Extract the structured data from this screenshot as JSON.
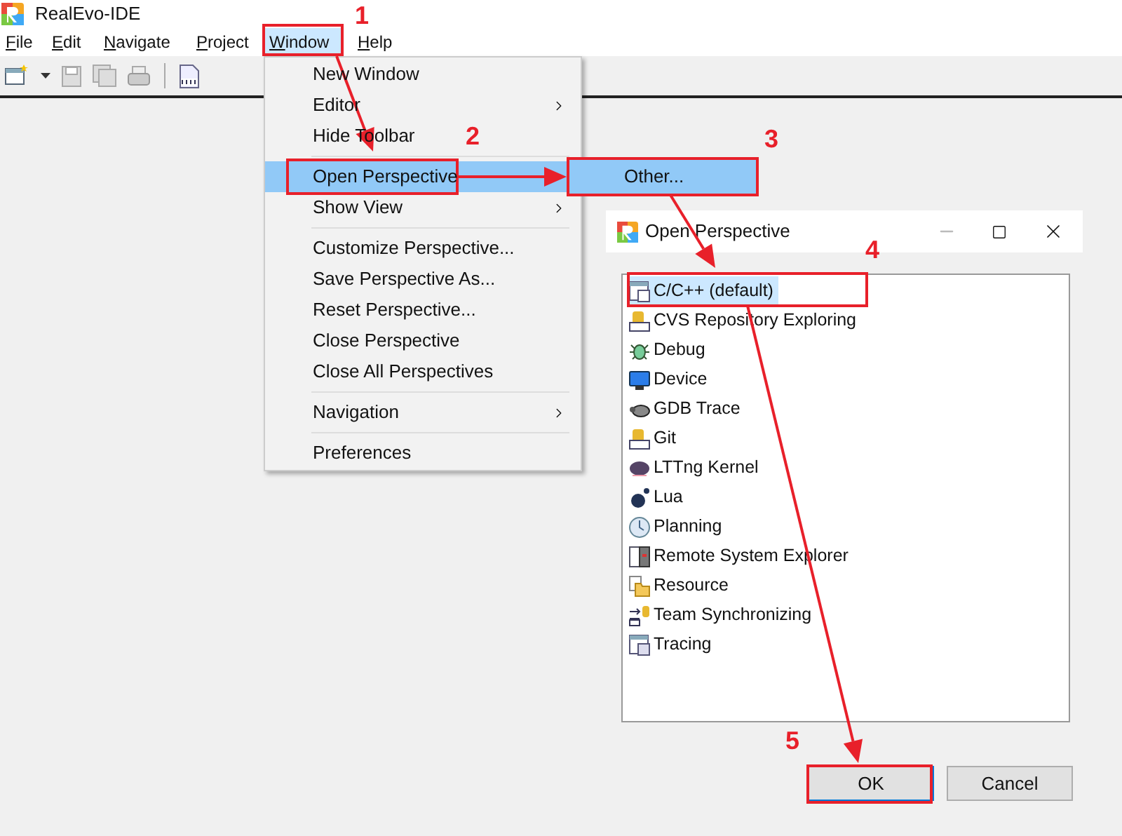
{
  "window": {
    "title": "RealEvo-IDE"
  },
  "menu_bar": [
    {
      "label": "File",
      "selected": false
    },
    {
      "label": "Edit",
      "selected": false
    },
    {
      "label": "Navigate",
      "selected": false
    },
    {
      "label": "Project",
      "selected": false
    },
    {
      "label": "Window",
      "selected": true
    },
    {
      "label": "Help",
      "selected": false
    }
  ],
  "window_menu": [
    {
      "kind": "item",
      "label": "New Window",
      "selected": false
    },
    {
      "kind": "submenu",
      "label": "Editor",
      "selected": false
    },
    {
      "kind": "item",
      "label": "Hide Toolbar",
      "selected": false
    },
    {
      "kind": "separator"
    },
    {
      "kind": "item",
      "label": "Open Perspective",
      "selected": true
    },
    {
      "kind": "submenu",
      "label": "Show View",
      "selected": false
    },
    {
      "kind": "separator"
    },
    {
      "kind": "item",
      "label": "Customize Perspective...",
      "selected": false
    },
    {
      "kind": "item",
      "label": "Save Perspective As...",
      "selected": false
    },
    {
      "kind": "item",
      "label": "Reset Perspective...",
      "selected": false
    },
    {
      "kind": "item",
      "label": "Close Perspective",
      "selected": false
    },
    {
      "kind": "item",
      "label": "Close All Perspectives",
      "selected": false
    },
    {
      "kind": "separator"
    },
    {
      "kind": "submenu",
      "label": "Navigation",
      "selected": false
    },
    {
      "kind": "separator"
    },
    {
      "kind": "item",
      "label": "Preferences",
      "selected": false
    }
  ],
  "perspective_submenu": [
    {
      "label": "Other...",
      "selected": true
    }
  ],
  "dialog": {
    "title": "Open Perspective",
    "perspectives": [
      {
        "label": "C/C++ (default)",
        "selected": true
      },
      {
        "label": "CVS Repository Exploring",
        "selected": false
      },
      {
        "label": "Debug",
        "selected": false
      },
      {
        "label": "Device",
        "selected": false
      },
      {
        "label": "GDB Trace",
        "selected": false
      },
      {
        "label": "Git",
        "selected": false
      },
      {
        "label": "LTTng Kernel",
        "selected": false
      },
      {
        "label": "Lua",
        "selected": false
      },
      {
        "label": "Planning",
        "selected": false
      },
      {
        "label": "Remote System Explorer",
        "selected": false
      },
      {
        "label": "Resource",
        "selected": false
      },
      {
        "label": "Team Synchronizing",
        "selected": false
      },
      {
        "label": "Tracing",
        "selected": false
      }
    ],
    "buttons": [
      {
        "label": "OK",
        "default": true
      },
      {
        "label": "Cancel",
        "default": false
      }
    ]
  },
  "annotations": [
    {
      "label": "1"
    },
    {
      "label": "2"
    },
    {
      "label": "3"
    },
    {
      "label": "4"
    },
    {
      "label": "5"
    }
  ]
}
